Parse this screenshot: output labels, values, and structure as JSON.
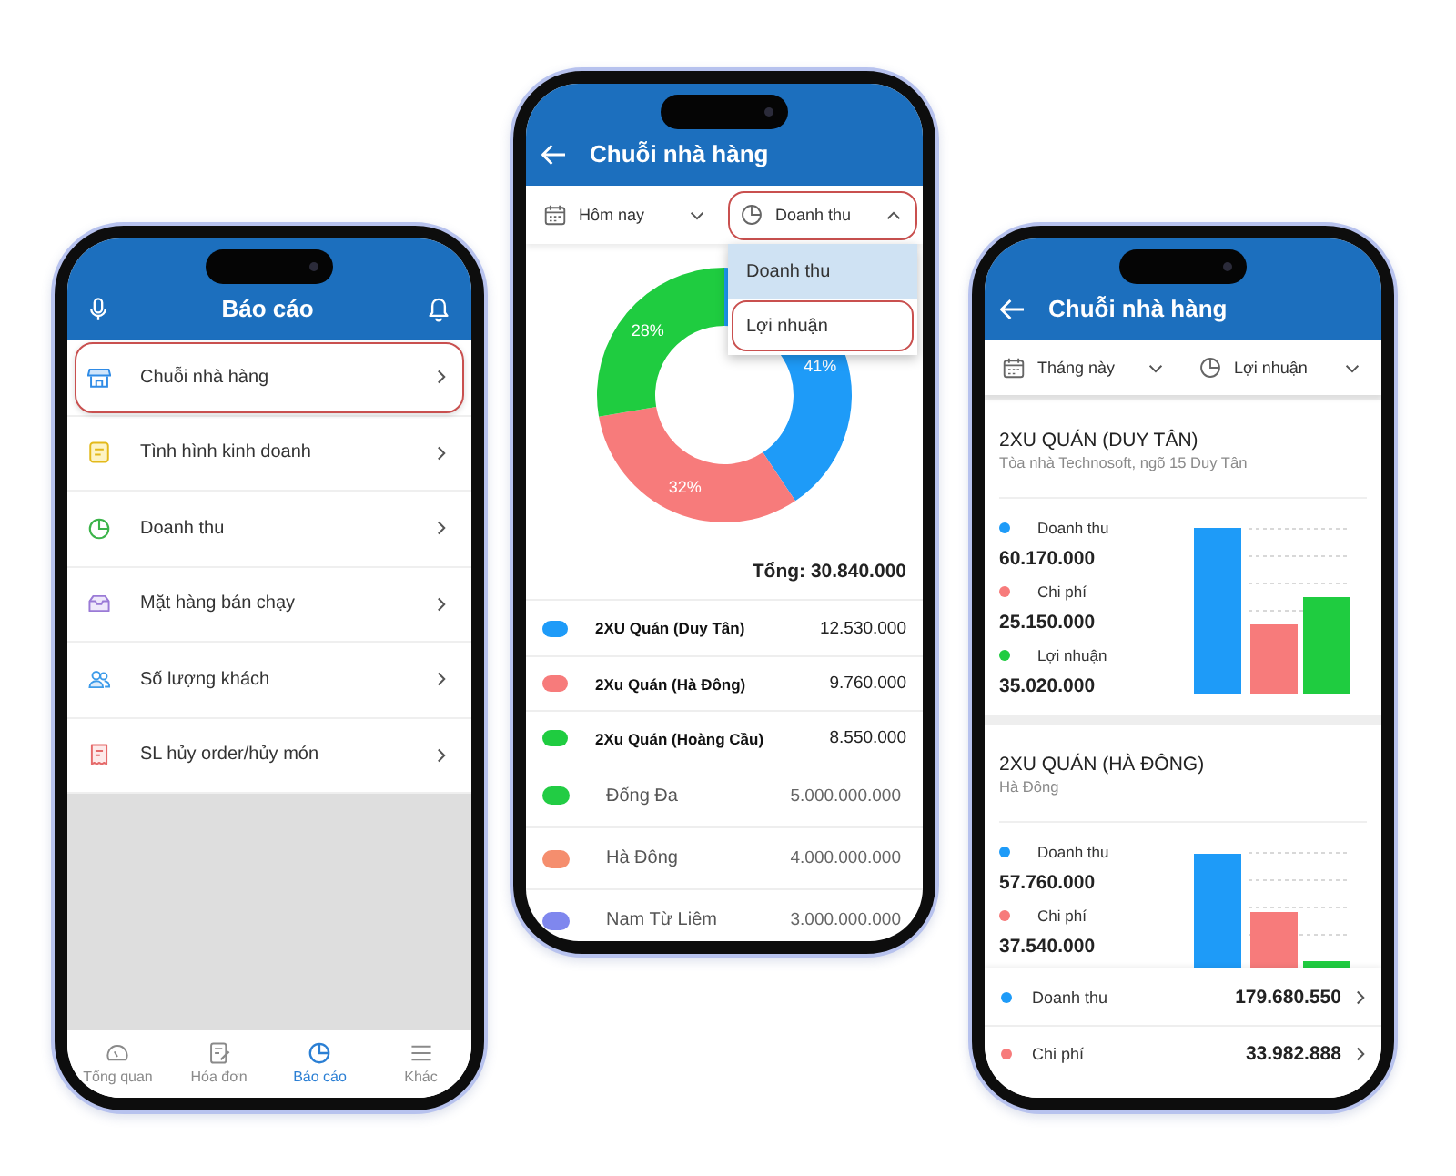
{
  "report_screen": {
    "title": "Báo cáo",
    "menu": [
      {
        "label": "Chuỗi nhà hàng",
        "highlighted": true
      },
      {
        "label": "Tình hình kinh doanh",
        "highlighted": false
      },
      {
        "label": "Doanh thu",
        "highlighted": false
      },
      {
        "label": "Mặt hàng bán chạy",
        "highlighted": false
      },
      {
        "label": "Số lượng khách",
        "highlighted": false
      },
      {
        "label": "SL hủy order/hủy món",
        "highlighted": false
      }
    ],
    "tabs": [
      {
        "label": "Tổng quan",
        "selected": false
      },
      {
        "label": "Hóa đơn",
        "selected": false
      },
      {
        "label": "Báo cáo",
        "selected": true
      },
      {
        "label": "Khác",
        "selected": false
      }
    ]
  },
  "chain_revenue_screen": {
    "title": "Chuỗi nhà hàng",
    "filters": [
      {
        "label": "Hôm nay",
        "open": false,
        "highlighted": false
      },
      {
        "label": "Doanh thu",
        "open": true,
        "highlighted": true
      }
    ],
    "dropdown": [
      {
        "label": "Doanh thu",
        "selected": true,
        "highlighted": false
      },
      {
        "label": "Lợi nhuận",
        "selected": false,
        "highlighted": true
      }
    ],
    "chart_data": {
      "type": "donut",
      "values": [
        41,
        32,
        28
      ],
      "value_labels": [
        "41%",
        "32%",
        "28%"
      ]
    },
    "total": "Tổng: 30.840.000",
    "restaurants": [
      {
        "kind": "chain",
        "name": "2XU Quán (Duy Tân)",
        "value": "12.530.000",
        "color": "#1e9bf8"
      },
      {
        "kind": "chain",
        "name": "2Xu Quán (Hà Đông)",
        "value": "9.760.000",
        "color": "#f77b7b"
      },
      {
        "kind": "chain",
        "name": "2Xu Quán (Hoàng Cầu)",
        "value": "8.550.000",
        "color": "#1fcc40"
      },
      {
        "kind": "district",
        "name": "Đống Đa",
        "value": "5.000.000.000",
        "color": "#22cc44"
      },
      {
        "kind": "district",
        "name": "Hà Đông",
        "value": "4.000.000.000",
        "color": "#f58e6e"
      },
      {
        "kind": "district",
        "name": "Nam Từ Liêm",
        "value": "3.000.000.000",
        "color": "#7f87ee"
      }
    ]
  },
  "chain_profit_screen": {
    "title": "Chuỗi nhà hàng",
    "filters": [
      {
        "label": "Tháng này",
        "open": false
      },
      {
        "label": "Lợi nhuận",
        "open": false
      }
    ],
    "branches": [
      {
        "name": "2XU QUÁN (DUY TÂN)",
        "address": "Tòa nhà Technosoft, ngõ 15 Duy Tân",
        "metrics": [
          {
            "label": "Doanh thu",
            "value": "60.170.000",
            "color": "#1e9bf8"
          },
          {
            "label": "Chi phí",
            "value": "25.150.000",
            "color": "#f77b7b"
          },
          {
            "label": "Lợi nhuận",
            "value": "35.020.000",
            "color": "#1fcc40"
          }
        ]
      },
      {
        "name": "2XU QUÁN (HÀ ĐÔNG)",
        "address": "Hà Đông",
        "metrics": [
          {
            "label": "Doanh thu",
            "value": "57.760.000",
            "color": "#1e9bf8"
          },
          {
            "label": "Chi phí",
            "value": "37.540.000",
            "color": "#f77b7b"
          }
        ]
      }
    ],
    "summary": [
      {
        "label": "Doanh thu",
        "value": "179.680.550",
        "color": "#1e9bf8"
      },
      {
        "label": "Chi phí",
        "value": "33.982.888",
        "color": "#f77b7b"
      }
    ]
  }
}
